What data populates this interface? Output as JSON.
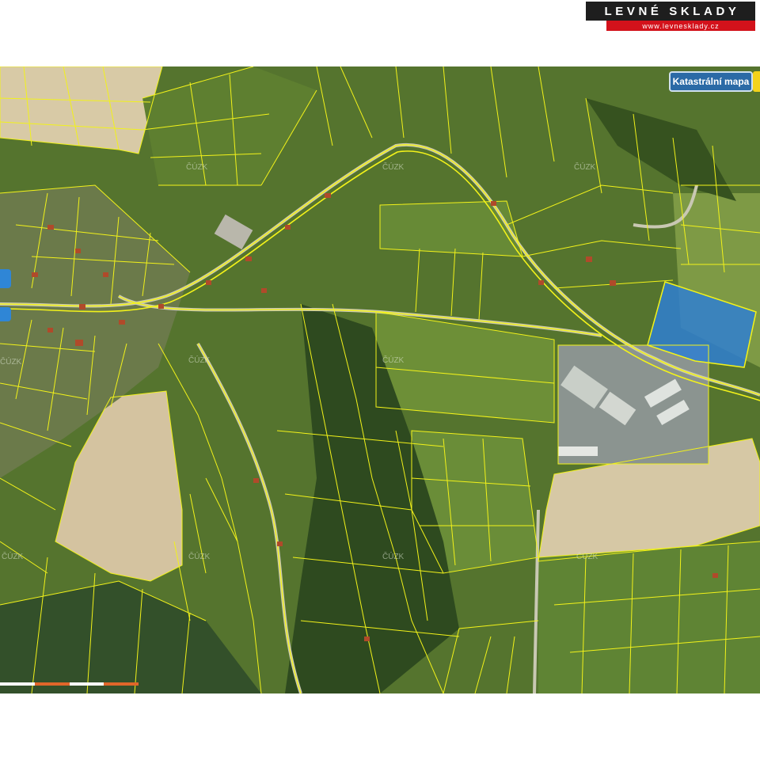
{
  "logo": {
    "title": "LEVNÉ SKLADY",
    "url": "www.levnesklady.cz"
  },
  "map": {
    "layer_button_label": "Katastrální mapa",
    "watermark": "ČÚZK",
    "colors": {
      "parcel_lines": "#f2f21a",
      "highlighted_parcel": "#2f7fd1",
      "fields_bare": "#d6c7a2",
      "meadow": "#6e8c3a",
      "forest": "#2f4a1e"
    },
    "scale_bar_colors": [
      "#ffffff",
      "#e0662a",
      "#ffffff",
      "#e0662a"
    ]
  }
}
